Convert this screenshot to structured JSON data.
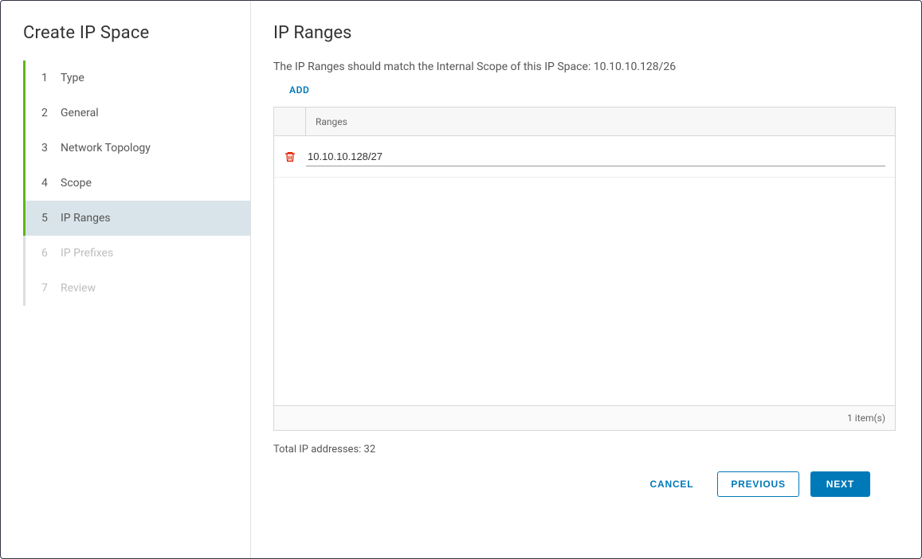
{
  "sidebar": {
    "title": "Create IP Space",
    "steps": [
      {
        "num": "1",
        "label": "Type",
        "state": "completed"
      },
      {
        "num": "2",
        "label": "General",
        "state": "completed"
      },
      {
        "num": "3",
        "label": "Network Topology",
        "state": "completed"
      },
      {
        "num": "4",
        "label": "Scope",
        "state": "completed"
      },
      {
        "num": "5",
        "label": "IP Ranges",
        "state": "active"
      },
      {
        "num": "6",
        "label": "IP Prefixes",
        "state": "disabled"
      },
      {
        "num": "7",
        "label": "Review",
        "state": "disabled"
      }
    ]
  },
  "main": {
    "title": "IP Ranges",
    "description": "The IP Ranges should match the Internal Scope of this IP Space: 10.10.10.128/26",
    "add_label": "ADD",
    "table": {
      "header_ranges": "Ranges",
      "rows": [
        {
          "value": "10.10.10.128/27"
        }
      ],
      "footer_count": "1 item(s)"
    },
    "total_line": "Total IP addresses: 32"
  },
  "footer": {
    "cancel": "CANCEL",
    "previous": "PREVIOUS",
    "next": "NEXT"
  }
}
